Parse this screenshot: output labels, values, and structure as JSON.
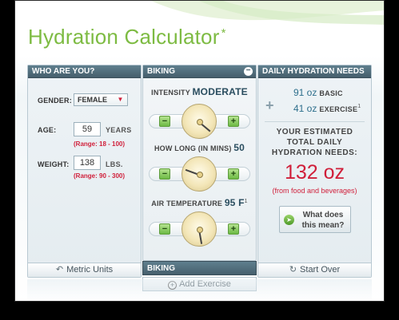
{
  "title": "Hydration Calculator",
  "title_mark": "*",
  "colors": {
    "title_green": "#7dbb42",
    "header_bg": "#52707e",
    "accent_red": "#d01f3a",
    "amount_blue": "#2e6f8c"
  },
  "who": {
    "header": "WHO ARE YOU?",
    "gender_label": "GENDER:",
    "gender_value": "FEMALE",
    "age_label": "AGE:",
    "age_value": "59",
    "age_unit": "YEARS",
    "age_range": "(Range: 18 - 100)",
    "weight_label": "WEIGHT:",
    "weight_value": "138",
    "weight_unit": "LBS.",
    "weight_range": "(Range: 90 - 300)",
    "footer": "Metric Units",
    "footer_icon": "undo-arrow-icon"
  },
  "biking": {
    "header": "BIKING",
    "remove_icon": "minus-circle-icon",
    "intensity_label": "INTENSITY",
    "intensity_value": "MODERATE",
    "duration_label": "HOW LONG (IN MINS)",
    "duration_value": "50",
    "temp_label": "AIR TEMPERATURE",
    "temp_value": "95 F",
    "temp_note": "1",
    "minus": "−",
    "plus": "+",
    "tab_label": "BIKING",
    "add_label": "Add Exercise"
  },
  "needs": {
    "header": "DAILY HYDRATION NEEDS",
    "basic_amount": "91 oz",
    "basic_tag": "BASIC",
    "exercise_amount": "41 oz",
    "exercise_tag": "EXERCISE",
    "exercise_note": "1",
    "plus_symbol": "+",
    "estimate_line1": "YOUR ESTIMATED",
    "estimate_line2": "TOTAL DAILY",
    "estimate_line3": "HYDRATION NEEDS:",
    "total": "132 oz",
    "total_sub": "(from food and beverages)",
    "what_line1": "What does",
    "what_line2": "this mean?",
    "footer": "Start Over",
    "footer_icon": "refresh-icon"
  }
}
